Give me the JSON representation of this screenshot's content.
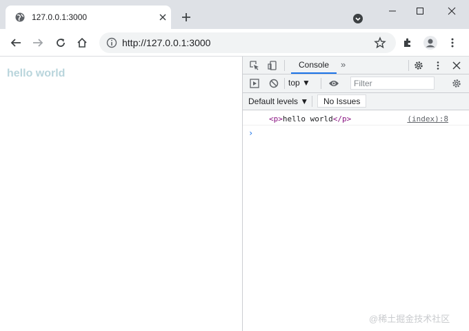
{
  "tab": {
    "title": "127.0.0.1:3000"
  },
  "toolbar": {
    "url": "http://127.0.0.1:3000"
  },
  "page": {
    "text": "hello world"
  },
  "devtools": {
    "active_tab": "Console",
    "more_tabs": "»",
    "context": "top ▼",
    "filter_placeholder": "Filter",
    "levels": "Default levels ▼",
    "issues": "No Issues",
    "log": {
      "open_tag": "<p>",
      "text": "hello world",
      "close_tag": "</p>",
      "source": "(index):8"
    },
    "prompt": "›"
  },
  "watermark": "@稀土掘金技术社区"
}
